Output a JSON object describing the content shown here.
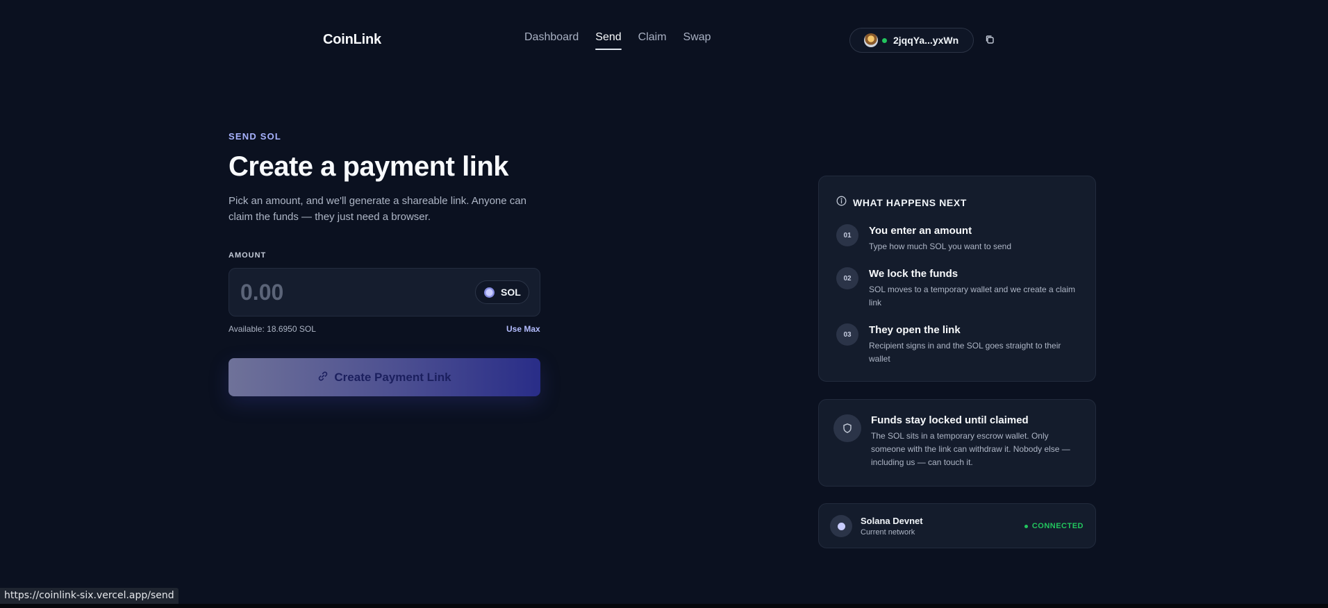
{
  "header": {
    "brand": "CoinLink",
    "nav": [
      {
        "label": "Dashboard",
        "active": false
      },
      {
        "label": "Send",
        "active": true
      },
      {
        "label": "Claim",
        "active": false
      },
      {
        "label": "Swap",
        "active": false
      }
    ],
    "wallet": {
      "address": "2jqqYa...yxWn",
      "connected_color": "#22c55e"
    },
    "copy_icon": "copy-icon"
  },
  "main": {
    "eyebrow": "SEND SOL",
    "title": "Create a payment link",
    "subtitle": "Pick an amount, and we'll generate a shareable link. Anyone can claim the funds — they just need a browser.",
    "amount": {
      "label": "AMOUNT",
      "value": "",
      "placeholder": "0.00",
      "token": "SOL",
      "available": "Available: 18.6950 SOL",
      "use_max": "Use Max"
    },
    "create_button": {
      "label": "Create Payment Link",
      "icon": "link-icon"
    }
  },
  "sidebar": {
    "next_steps": {
      "heading": "WHAT HAPPENS NEXT",
      "icon": "info-icon",
      "steps": [
        {
          "num": "01",
          "title": "You enter an amount",
          "desc": "Type how much SOL you want to send"
        },
        {
          "num": "02",
          "title": "We lock the funds",
          "desc": "SOL moves to a temporary wallet and we create a claim link"
        },
        {
          "num": "03",
          "title": "They open the link",
          "desc": "Recipient signs in and the SOL goes straight to their wallet"
        }
      ]
    },
    "security": {
      "icon": "shield-icon",
      "title": "Funds stay locked until claimed",
      "desc": "The SOL sits in a temporary escrow wallet. Only someone with the link can withdraw it. Nobody else — including us — can touch it."
    },
    "network": {
      "name": "Solana Devnet",
      "sub": "Current network",
      "status": "CONNECTED",
      "status_color": "#22c55e"
    }
  },
  "statusbar": {
    "url": "https://coinlink-six.vercel.app/send"
  },
  "colors": {
    "background": "#0b1120",
    "accent": "#a8b3ff",
    "card": "#141c2c"
  }
}
